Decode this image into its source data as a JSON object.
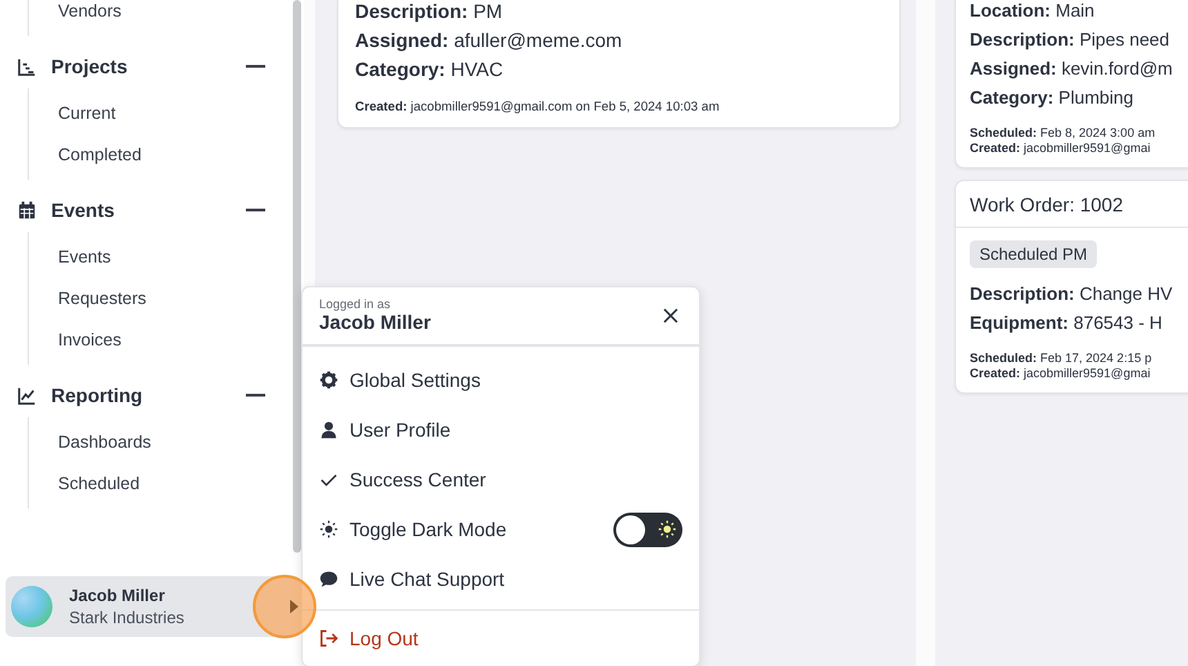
{
  "sidebar": {
    "top_item": "Vendors",
    "groups": [
      {
        "title": "Projects",
        "expanded": true,
        "items": [
          "Current",
          "Completed"
        ]
      },
      {
        "title": "Events",
        "expanded": true,
        "items": [
          "Events",
          "Requesters",
          "Invoices"
        ]
      },
      {
        "title": "Reporting",
        "expanded": true,
        "items": [
          "Dashboards",
          "Scheduled"
        ]
      }
    ],
    "user": {
      "name": "Jacob Miller",
      "company": "Stark Industries"
    }
  },
  "board": {
    "columns": [
      {
        "cards": [
          {
            "fields": [
              {
                "label": "Description:",
                "value": "PM"
              },
              {
                "label": "Assigned:",
                "value": "afuller@meme.com"
              },
              {
                "label": "Category:",
                "value": "HVAC"
              }
            ],
            "meta": [
              {
                "label": "Created:",
                "value": "jacobmiller9591@gmail.com on Feb 5, 2024 10:03 am"
              }
            ]
          }
        ]
      },
      {
        "cards": [
          {
            "fields": [
              {
                "label": "Location:",
                "value": "Main"
              },
              {
                "label": "Description:",
                "value": "Pipes need"
              },
              {
                "label": "Assigned:",
                "value": "kevin.ford@m"
              },
              {
                "label": "Category:",
                "value": "Plumbing"
              }
            ],
            "meta": [
              {
                "label": "Scheduled:",
                "value": "Feb 8, 2024 3:00 am"
              },
              {
                "label": "Created:",
                "value": "jacobmiller9591@gmai"
              }
            ]
          },
          {
            "title": "Work Order: 1002",
            "tag": "Scheduled PM",
            "fields": [
              {
                "label": "Description:",
                "value": "Change HV"
              },
              {
                "label": "Equipment:",
                "value": "876543 - H"
              }
            ],
            "meta": [
              {
                "label": "Scheduled:",
                "value": "Feb 17, 2024 2:15 p"
              },
              {
                "label": "Created:",
                "value": "jacobmiller9591@gmai"
              }
            ]
          }
        ]
      }
    ]
  },
  "user_menu": {
    "caption": "Logged in as",
    "name": "Jacob Miller",
    "items": [
      {
        "kind": "link",
        "label": "Global Settings"
      },
      {
        "kind": "link",
        "label": "User Profile"
      },
      {
        "kind": "link",
        "label": "Success Center"
      },
      {
        "kind": "toggle",
        "label": "Toggle Dark Mode",
        "on": false
      },
      {
        "kind": "link",
        "label": "Live Chat Support"
      },
      {
        "kind": "logout",
        "label": "Log Out"
      }
    ]
  }
}
